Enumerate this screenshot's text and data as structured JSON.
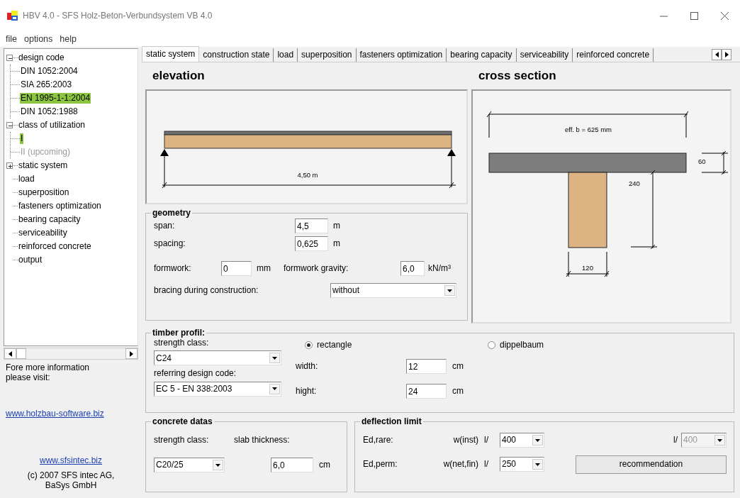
{
  "window": {
    "title": "HBV 4.0 - SFS Holz-Beton-Verbundsystem VB 4.0"
  },
  "menu": [
    "file",
    "options",
    "help"
  ],
  "tree": [
    {
      "label": "design code",
      "expanded": true,
      "selected": false,
      "disabled": false,
      "children": [
        {
          "label": "DIN 1052:2004",
          "selected": false,
          "disabled": false
        },
        {
          "label": "SIA 265:2003",
          "selected": false,
          "disabled": false
        },
        {
          "label": "EN 1995-1-1:2004",
          "selected": true,
          "disabled": false
        },
        {
          "label": "DIN 1052:1988",
          "selected": false,
          "disabled": false
        }
      ]
    },
    {
      "label": "class of utilization",
      "expanded": true,
      "selected": false,
      "disabled": false,
      "children": [
        {
          "label": "I",
          "selected": true,
          "disabled": false
        },
        {
          "label": "II (upcoming)",
          "selected": false,
          "disabled": true
        }
      ]
    },
    {
      "label": "static system",
      "expanded": false,
      "selected": false,
      "disabled": false
    },
    {
      "label": "load",
      "selected": false,
      "disabled": false
    },
    {
      "label": "superposition",
      "selected": false,
      "disabled": false
    },
    {
      "label": "fasteners optimization",
      "selected": false,
      "disabled": false
    },
    {
      "label": "bearing capacity",
      "selected": false,
      "disabled": false
    },
    {
      "label": "serviceability",
      "selected": false,
      "disabled": false
    },
    {
      "label": "reinforced concrete",
      "selected": false,
      "disabled": false
    },
    {
      "label": "output",
      "selected": false,
      "disabled": false
    }
  ],
  "sidebar": {
    "info": "Fore more information please visit:",
    "links": [
      "www.holzbau-software.biz",
      "www.sfsintec.biz"
    ],
    "copyright": "(c) 2007 SFS intec AG, BaSys GmbH"
  },
  "tabs": [
    {
      "label": "static system",
      "selected": true
    },
    {
      "label": "construction state",
      "selected": false
    },
    {
      "label": "load",
      "selected": false
    },
    {
      "label": "superposition",
      "selected": false
    },
    {
      "label": "fasteners optimization",
      "selected": false
    },
    {
      "label": "bearing capacity",
      "selected": false
    },
    {
      "label": "serviceability",
      "selected": false
    },
    {
      "label": "reinforced concrete",
      "selected": false
    }
  ],
  "elevation": {
    "heading": "elevation",
    "span_dimension": "4,50 m"
  },
  "cross_section": {
    "heading": "cross section",
    "width_dimension": "eff. b = 625 mm",
    "slab_dimension": "60",
    "timber_height_dimension": "240",
    "timber_width_dimension": "120"
  },
  "geometry": {
    "legend": "geometry",
    "span": {
      "label": "span:",
      "value": "4,5",
      "unit": "m"
    },
    "spacing": {
      "label": "spacing:",
      "value": "0,625",
      "unit": "m"
    },
    "formwork": {
      "label": "formwork:",
      "value": "0",
      "unit": "mm"
    },
    "formwork_gravity": {
      "label": "formwork gravity:",
      "value": "6,0",
      "unit": "kN/m³"
    },
    "bracing": {
      "label": "bracing during construction:",
      "value": "without"
    }
  },
  "timber_profile": {
    "legend": "timber profil:",
    "strength_class": {
      "label": "strength class:",
      "value": "C24"
    },
    "design_code": {
      "label": "referring design code:",
      "value": "EC 5 - EN 338:2003"
    },
    "shapes": [
      {
        "label": "rectangle",
        "selected": true
      },
      {
        "label": "dippelbaum",
        "selected": false
      }
    ],
    "width": {
      "label": "width:",
      "value": "12",
      "unit": "cm"
    },
    "height": {
      "label": "hight:",
      "value": "24",
      "unit": "cm"
    }
  },
  "concrete": {
    "legend": "concrete datas",
    "strength_class": {
      "label": "strength class:",
      "value": "C20/25"
    },
    "slab_thickness": {
      "label": "slab thickness:",
      "value": "6,0",
      "unit": "cm"
    }
  },
  "deflection": {
    "legend": "deflection limit",
    "rows": [
      {
        "label": "Ed,rare:",
        "symbol": "w(inst)",
        "ratio": "l/",
        "value": "400"
      },
      {
        "label": "Ed,perm:",
        "symbol": "w(net,fin)",
        "ratio": "l/",
        "value": "250"
      }
    ],
    "extra": {
      "ratio": "l/",
      "value": "400",
      "disabled": true
    },
    "button": "recommendation"
  }
}
